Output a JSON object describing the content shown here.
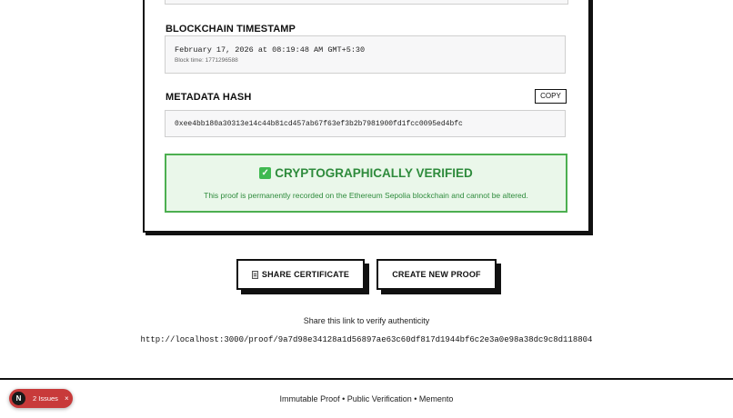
{
  "timestamp": {
    "label": "BLOCKCHAIN TIMESTAMP",
    "value": "February 17, 2026 at 08:19:48 AM GMT+5:30",
    "sub": "Block time: 1771296588"
  },
  "metadata": {
    "label": "METADATA HASH",
    "copy_label": "COPY",
    "hash": "0xee4bb180a30313e14c44b81cd457ab67f63ef3b2b7981900fd1fcc0095ed4bfc"
  },
  "verified": {
    "title": "CRYPTOGRAPHICALLY VERIFIED",
    "message": "This proof is permanently recorded on the Ethereum Sepolia blockchain and cannot be altered."
  },
  "actions": {
    "share_label": "SHARE CERTIFICATE",
    "new_proof_label": "CREATE NEW PROOF"
  },
  "share": {
    "text": "Share this link to verify authenticity",
    "url": "http://localhost:3000/proof/9a7d98e34128a1d56897ae63c60df817d1944bf6c2e3a0e98a38dc9c8d118804"
  },
  "footer": {
    "text": "Immutable Proof • Public Verification • Memento"
  },
  "dev_overlay": {
    "logo": "N",
    "issues_label": "2 Issues",
    "close": "×"
  },
  "colors": {
    "accent_green": "#4caf50",
    "issues_red": "#c83a3a"
  }
}
